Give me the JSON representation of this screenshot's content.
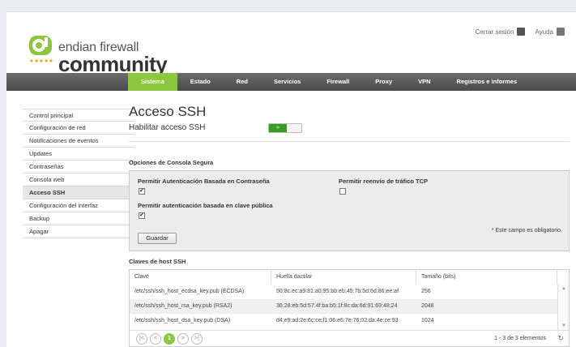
{
  "header": {
    "brand_line1": "endian firewall",
    "brand_line2": "community",
    "logout_label": "Cerrar sesión",
    "help_label": "Ayuda"
  },
  "nav": {
    "items": [
      "Sistema",
      "Estado",
      "Red",
      "Servicios",
      "Firewall",
      "Proxy",
      "VPN",
      "Registros e informes"
    ],
    "active": "Sistema"
  },
  "sidebar": {
    "items": [
      {
        "label": "Control principal"
      },
      {
        "label": "Configuración de red"
      },
      {
        "label": "Notificaciones de eventos"
      },
      {
        "label": "Updates"
      },
      {
        "label": "Contraseñas"
      },
      {
        "label": "Consola web"
      },
      {
        "label": "Acceso SSH"
      },
      {
        "label": "Configuración del interfaz"
      },
      {
        "label": "Backup"
      },
      {
        "label": "Apagar"
      }
    ],
    "active_index": 6
  },
  "main": {
    "title": "Acceso SSH",
    "enable_label": "Habilitar acceso SSH",
    "toggle_on_symbol": "»",
    "toggle_state": "on",
    "console_section_title": "Opciones de Consola Segura",
    "password_auth_label": "Permitir Autenticación Basada en Contraseña",
    "password_auth_checked": true,
    "tcp_forward_label": "Permitir reenvío de tráfico TCP",
    "tcp_forward_checked": false,
    "pubkey_auth_label": "Permitir autenticación basada en clave pública",
    "pubkey_auth_checked": true,
    "save_label": "Guardar",
    "required_note": "* Este campo es obligatorio.",
    "keys_section_title": "Claves de host SSH",
    "table": {
      "headers": [
        "Clave",
        "Huella dactilar",
        "Tamaño (bits)"
      ],
      "rows": [
        [
          "/etc/ssh/ssh_host_ecdsa_key.pub (ECDSA)",
          "50:8c:ec:a9:81:a0:95:bb:eb:45:7b:5d:6d:86:ee:af",
          "256"
        ],
        [
          "/etc/ssh/ssh_host_rsa_key.pub (RSA2)",
          "36:28:eb:5d:57:4f:ba:b5:1f:8c:da:6d:91:69:48:24",
          "2048"
        ],
        [
          "/etc/ssh/ssh_host_dsa_key.pub (DSA)",
          "d4:e9:ad:2e:6c:ce:f1:06:e6:7e:76:02:da:4e:ce:93",
          "1024"
        ]
      ]
    },
    "pager": {
      "first": "|<",
      "prev": "<",
      "current_page": "1",
      "next": ">",
      "last": ">|",
      "info": "1 - 3 de 3 elementos",
      "refresh_symbol": "↻"
    }
  },
  "colors": {
    "accent_green": "#8dc63f",
    "toggle_green": "#3a9a24",
    "nav_gray": "#5a5a5a"
  }
}
